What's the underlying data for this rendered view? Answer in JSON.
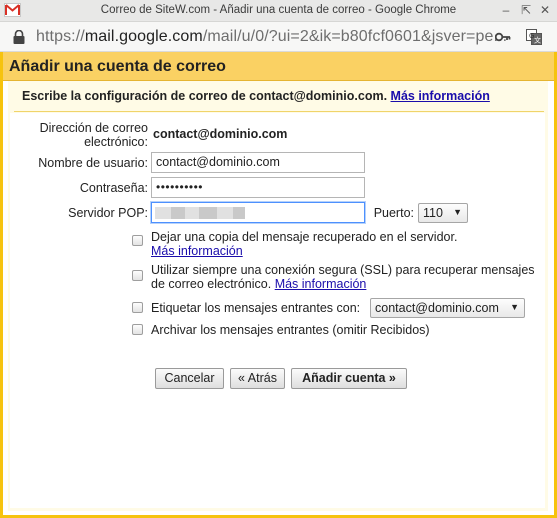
{
  "window": {
    "title": "Correo de SiteW.com - Añadir una cuenta de correo - Google Chrome"
  },
  "urlbar": {
    "url_scheme": "https://",
    "url_host": "mail.google.com",
    "url_path": "/mail/u/0/?ui=2&ik=b80fcf0601&jsver=pe..."
  },
  "dialog": {
    "title": "Añadir una cuenta de correo",
    "subheader": "Escribe la configuración de correo de contact@dominio.com.",
    "more_info_link": "Más información",
    "email_label": "Dirección de correo electrónico:",
    "email_value": "contact@dominio.com",
    "username_label": "Nombre de usuario:",
    "username_value": "contact@dominio.com",
    "password_label": "Contraseña:",
    "password_mask": "••••••••••",
    "pop_label": "Servidor POP:",
    "port_label": "Puerto:",
    "port_value": "110",
    "options": {
      "leave_copy": "Dejar una copia del mensaje recuperado en el servidor.",
      "leave_copy_link": "Más información",
      "ssl_text": "Utilizar siempre una conexión segura (SSL) para recuperar mensajes de correo electrónico.",
      "ssl_link": "Más información",
      "label_incoming": "Etiquetar los mensajes entrantes con:",
      "label_select": "contact@dominio.com",
      "archive": "Archivar los mensajes entrantes (omitir Recibidos)"
    },
    "buttons": {
      "cancel": "Cancelar",
      "back": "« Atrás",
      "add": "Añadir cuenta »"
    }
  },
  "colors": {
    "header_bg": "#fad163",
    "border": "#f6c30e",
    "link": "#1a0dab",
    "focus": "#4d90fe"
  },
  "icons": [
    "gmail-logo-icon",
    "minimize-icon",
    "maximize-icon",
    "close-icon",
    "lock-icon",
    "key-icon",
    "translate-icon",
    "chevron-down-icon"
  ]
}
